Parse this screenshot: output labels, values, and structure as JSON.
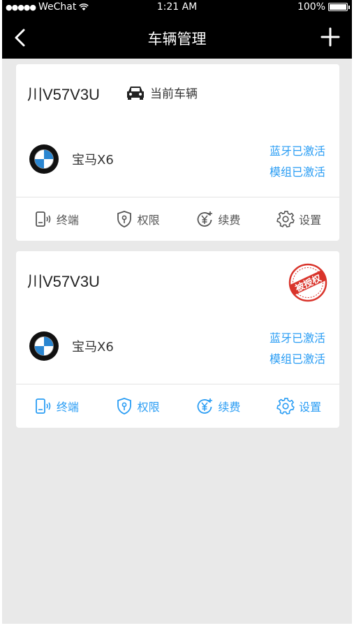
{
  "status_bar": {
    "carrier": "WeChat",
    "time": "1:21 AM",
    "battery": "100%"
  },
  "navbar": {
    "title": "车辆管理"
  },
  "vehicles": [
    {
      "plate": "川V57V3U",
      "current_label": "当前车辆",
      "brand": "宝马X6",
      "bluetooth_status": "蓝牙已激活",
      "module_status": "模组已激活",
      "actions": [
        "终端",
        "权限",
        "续费",
        "设置"
      ]
    },
    {
      "plate": "川V57V3U",
      "stamp": "被授权",
      "brand": "宝马X6",
      "bluetooth_status": "蓝牙已激活",
      "module_status": "模组已激活",
      "actions": [
        "终端",
        "权限",
        "续费",
        "设置"
      ]
    }
  ],
  "colors": {
    "accent": "#2a9df4",
    "header_bg": "#000000",
    "page_bg": "#e9e9e9",
    "stamp_red": "#d9342b"
  }
}
